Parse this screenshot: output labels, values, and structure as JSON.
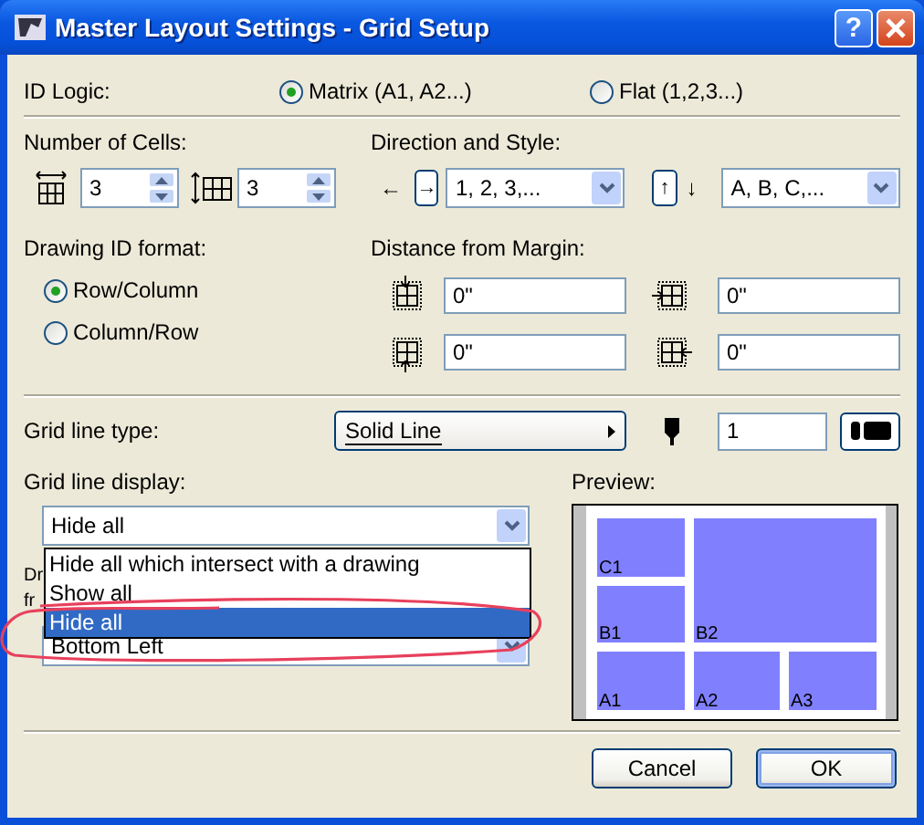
{
  "window": {
    "title": "Master Layout Settings - Grid Setup",
    "help": "?"
  },
  "id_logic": {
    "label": "ID Logic:",
    "options": [
      {
        "label": "Matrix (A1, A2...)",
        "selected": true
      },
      {
        "label": "Flat (1,2,3...)",
        "selected": false
      }
    ]
  },
  "number_of_cells": {
    "label": "Number of Cells:",
    "columns": "3",
    "rows": "3"
  },
  "direction_and_style": {
    "label": "Direction and Style:",
    "horizontal": {
      "arrow": "←",
      "button": "→",
      "value": "1, 2, 3,..."
    },
    "vertical": {
      "button": "↑",
      "arrow": "↓",
      "value": "A, B, C,..."
    }
  },
  "drawing_id_format": {
    "label": "Drawing ID format:",
    "options": [
      {
        "label": "Row/Column",
        "selected": true
      },
      {
        "label": "Column/Row",
        "selected": false
      }
    ]
  },
  "distance_from_margin": {
    "label": "Distance from Margin:",
    "fields": [
      {
        "kind": "top",
        "value": "0\""
      },
      {
        "kind": "left",
        "value": "0\""
      },
      {
        "kind": "bottom",
        "value": "0\""
      },
      {
        "kind": "right",
        "value": "0\""
      }
    ]
  },
  "grid_line_type": {
    "label": "Grid line type:",
    "value": "Solid Line",
    "pen": "1"
  },
  "grid_line_display": {
    "label": "Grid line display:",
    "value": "Hide all",
    "expanded": true,
    "options": [
      {
        "label": "Hide all which intersect with a drawing",
        "selected": false
      },
      {
        "label": "Show all",
        "selected": false
      },
      {
        "label": "Hide all",
        "selected": true
      }
    ]
  },
  "obscured_label": {
    "lines": [
      "Dr",
      "fr"
    ]
  },
  "obscured_combo": {
    "value": "Bottom Left"
  },
  "annotation": {
    "kind": "ellipse",
    "color": "#e8405c"
  },
  "preview": {
    "label": "Preview:",
    "cells": [
      {
        "label": "C1"
      },
      {
        "label": "B1"
      },
      {
        "label": "B2"
      },
      {
        "label": "A1"
      },
      {
        "label": "A2"
      },
      {
        "label": "A3"
      }
    ]
  },
  "buttons": [
    {
      "label": "Cancel",
      "default": false
    },
    {
      "label": "OK",
      "default": true
    }
  ]
}
